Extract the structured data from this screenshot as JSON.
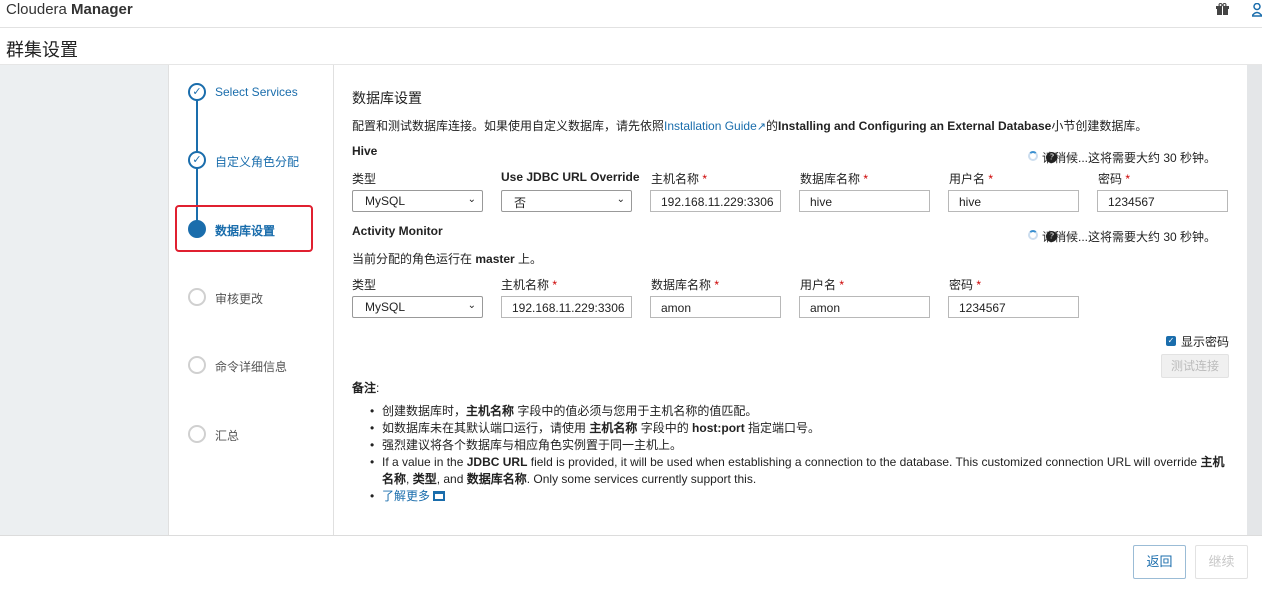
{
  "app": {
    "brand_light": "Cloudera ",
    "brand_bold": "Manager"
  },
  "page_title": "群集设置",
  "steps": [
    {
      "label": "Select Services",
      "state": "done"
    },
    {
      "label": "自定义角色分配",
      "state": "done"
    },
    {
      "label": "数据库设置",
      "state": "active"
    },
    {
      "label": "审核更改",
      "state": "todo"
    },
    {
      "label": "命令详细信息",
      "state": "todo"
    },
    {
      "label": "汇总",
      "state": "todo"
    }
  ],
  "main": {
    "title": "数据库设置",
    "intro_before": "配置和测试数据库连接。如果使用自定义数据库，请先依照",
    "intro_link": "Installation Guide",
    "intro_middle": "的",
    "intro_bold": "Installing and Configuring an External Database",
    "intro_after": "小节创建数据库。",
    "wait_text": "请稍候...这将需要大约 30 秒钟。",
    "hive": {
      "title": "Hive",
      "labels": {
        "type": "类型",
        "jdbc": "Use JDBC URL Override",
        "host": "主机名称",
        "dbname": "数据库名称",
        "user": "用户名",
        "password": "密码"
      },
      "values": {
        "type": "MySQL",
        "jdbc": "否",
        "host": "192.168.11.229:3306",
        "dbname": "hive",
        "user": "hive",
        "password": "1234567"
      }
    },
    "amon": {
      "title": "Activity Monitor",
      "assign_before": "当前分配的角色运行在 ",
      "assign_host": "master",
      "assign_after": " 上。",
      "labels": {
        "type": "类型",
        "host": "主机名称",
        "dbname": "数据库名称",
        "user": "用户名",
        "password": "密码"
      },
      "values": {
        "type": "MySQL",
        "host": "192.168.11.229:3306",
        "dbname": "amon",
        "user": "amon",
        "password": "1234567"
      }
    },
    "required_mark": "*",
    "show_password_label": "显示密码",
    "test_button": "测试连接",
    "notes_title": "备注",
    "notes_colon": ":",
    "notes": {
      "n1_a": "创建数据库时，",
      "n1_b": "主机名称",
      "n1_c": " 字段中的值必须与您用于主机名称的值匹配。",
      "n2_a": "如数据库未在其默认端口运行，请使用 ",
      "n2_b": "主机名称",
      "n2_c": " 字段中的 ",
      "n2_d": "host:port",
      "n2_e": " 指定端口号。",
      "n3": "强烈建议将各个数据库与相应角色实例置于同一主机上。",
      "n4_a": "If a value in the ",
      "n4_b": "JDBC URL",
      "n4_c": " field is provided, it will be used when establishing a connection to the database. This customized connection URL will override ",
      "n4_d": "主机名称",
      "n4_e": ", ",
      "n4_f": "类型",
      "n4_g": ", and ",
      "n4_h": "数据库名称",
      "n4_i": ". Only some services currently support this.",
      "n5_link": "了解更多"
    }
  },
  "footer": {
    "back": "返回",
    "next": "继续"
  },
  "colors": {
    "accent": "#1a6dac",
    "highlight": "#e02030"
  }
}
